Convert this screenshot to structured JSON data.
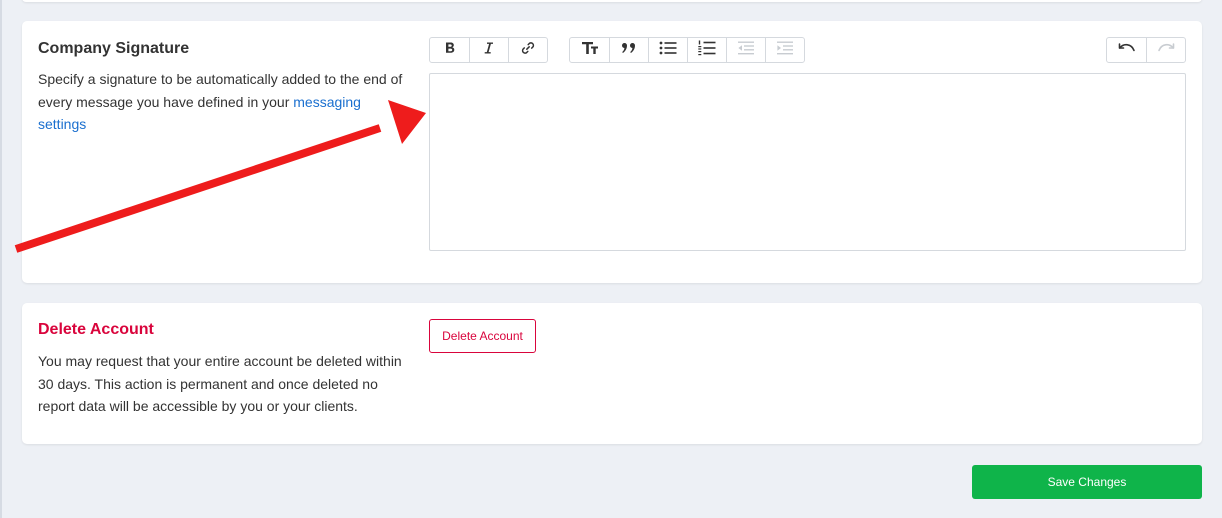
{
  "signature": {
    "title": "Company Signature",
    "description_prefix": "Specify a signature to be automatically added to the end of every message you have defined in your ",
    "link_text": "messaging settings",
    "editor_value": ""
  },
  "toolbar": {
    "format_icons": [
      "bold-icon",
      "italic-icon",
      "link-icon"
    ],
    "block_icons": [
      "heading-icon",
      "quote-icon",
      "bullet-list-icon",
      "numbered-list-icon",
      "outdent-icon",
      "indent-icon"
    ],
    "history_icons": [
      "undo-icon",
      "redo-icon"
    ]
  },
  "delete_account": {
    "title": "Delete Account",
    "description": "You may request that your entire account be deleted within 30 days. This action is permanent and once deleted no report data will be accessible by you or your clients.",
    "button_label": "Delete Account"
  },
  "footer": {
    "save_label": "Save Changes"
  },
  "colors": {
    "danger": "#d9043c",
    "link": "#1a6fcf",
    "save": "#0fb44a",
    "annotation_arrow": "#ee1c1c"
  }
}
